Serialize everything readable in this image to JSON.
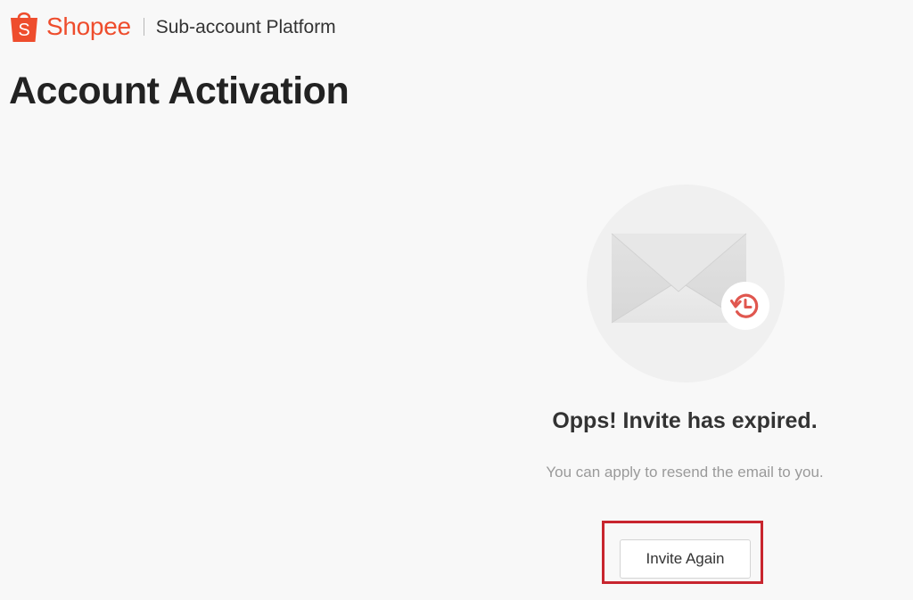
{
  "header": {
    "logo_text": "Shopee",
    "logo_glyph": "S",
    "platform_name": "Sub-account Platform",
    "brand_color": "#ee4d2d"
  },
  "page": {
    "title": "Account Activation"
  },
  "status": {
    "icon": "mail-expired-icon",
    "heading": "Opps! Invite has expired.",
    "description": "You can apply to resend the email to you.",
    "accent_color": "#e0574f"
  },
  "actions": {
    "invite_again_label": "Invite Again",
    "highlight_color": "#c8252e"
  }
}
